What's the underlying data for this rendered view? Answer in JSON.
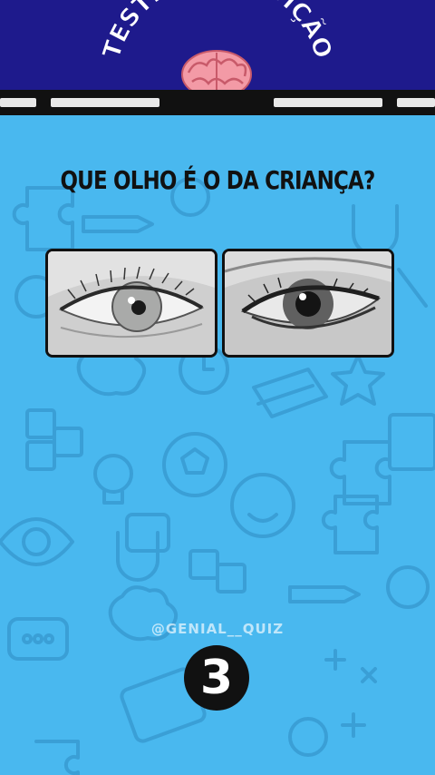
{
  "header": {
    "title": "TESTE DE INTUIÇÃO"
  },
  "question": "QUE OLHO É O DA CRIANÇA?",
  "options": [
    {
      "id": "eye-1",
      "icon": "light-eye-photo"
    },
    {
      "id": "eye-2",
      "icon": "dark-eye-photo"
    }
  ],
  "watermark": "@GENIAL__QUIZ",
  "timer": "3",
  "colors": {
    "header": "#1e1a8c",
    "background": "#49b8ef",
    "title": "#ffffff"
  }
}
